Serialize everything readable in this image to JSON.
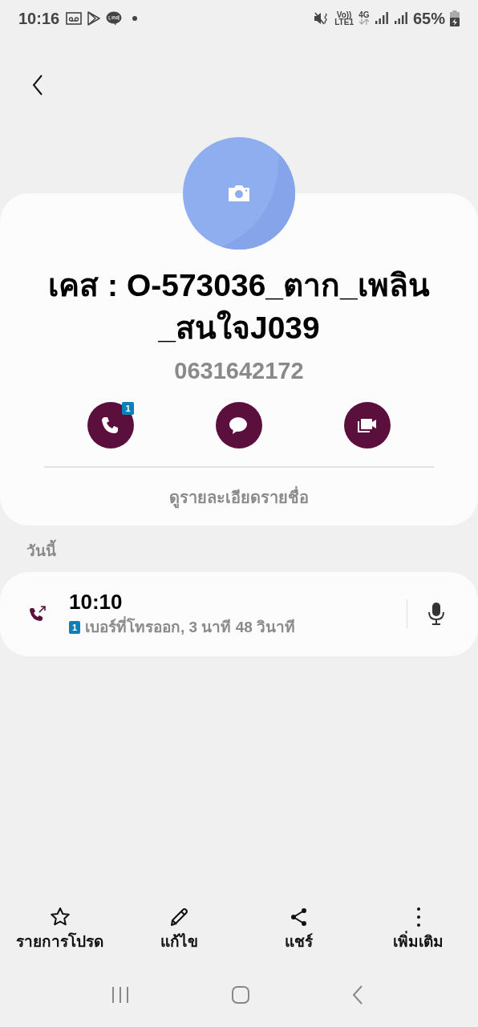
{
  "status_bar": {
    "time": "10:16",
    "indicators": [
      "Vo))",
      "LTE1",
      "4G"
    ],
    "battery": "65%"
  },
  "contact": {
    "name": "เคส : O-573036_ตาก_เพลิน_สนใจJ039",
    "number": "0631642172",
    "actions": [
      {
        "kind": "call",
        "badge": "1"
      },
      {
        "kind": "message"
      },
      {
        "kind": "video"
      }
    ],
    "details_link": "ดูรายละเอียดรายชื่อ"
  },
  "section_header": "วันนี้",
  "calls": [
    {
      "kind": "outgoing",
      "time": "10:10",
      "sim": "1",
      "description": "เบอร์ที่โทรออก, 3 นาที 48 วินาที"
    }
  ],
  "bottom_actions": [
    {
      "kind": "favorite",
      "label": "รายการโปรด"
    },
    {
      "kind": "edit",
      "label": "แก้ไข"
    },
    {
      "kind": "share",
      "label": "แชร์"
    },
    {
      "kind": "more",
      "label": "เพิ่มเติม"
    }
  ]
}
